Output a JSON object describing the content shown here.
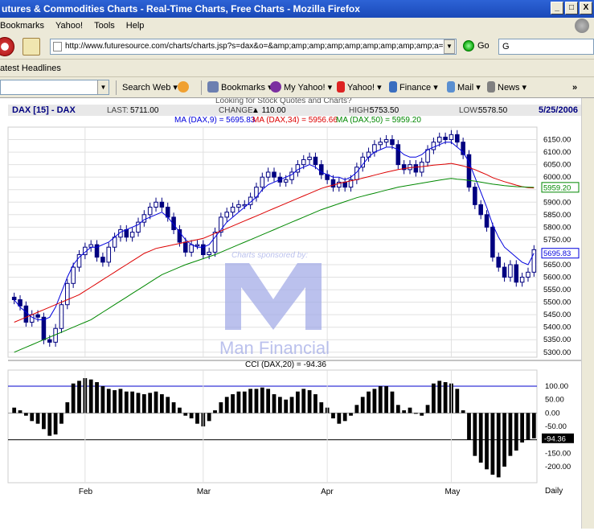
{
  "window": {
    "title": "utures & Commodities Charts - Real-Time Charts, Free Charts - Mozilla Firefox",
    "btn_min": "_",
    "btn_max": "□",
    "btn_close": "X"
  },
  "menu": {
    "items": [
      "Bookmarks",
      "Yahoo!",
      "Tools",
      "Help"
    ]
  },
  "nav": {
    "url": "http://www.futuresource.com/charts/charts.jsp?s=dax&o=&amp;amp;amp;amp;amp;amp;amp;amp;amp;a=",
    "go_label": "Go",
    "search_value": "G"
  },
  "bookmarks_bar": {
    "label": "atest Headlines"
  },
  "yahoo_toolbar": {
    "search_web": "Search Web ▾",
    "bookmarks": "Bookmarks ▾",
    "my_yahoo": "My Yahoo! ▾",
    "yahoo": "Yahoo! ▾",
    "finance": "Finance ▾",
    "mail": "Mail ▾",
    "news": "News ▾",
    "more": "»"
  },
  "chart_header": {
    "symbol": "DAX [15] - DAX",
    "last_label": "LAST:",
    "last": "5711.00",
    "change_label": "CHANGE:",
    "change": "▲ 110.00",
    "high_label": "HIGH:",
    "high": "5753.50",
    "low_label": "LOW:",
    "low": "5578.50",
    "date": "5/25/2006",
    "ma9": "MA (DAX,9) = 5695.83",
    "ma34": "MA (DAX,34) = 5956.66",
    "ma50": "MA (DAX,50) = 5959.20",
    "looking_for": "Looking for Stock Quotes and Charts?",
    "sponsor_text": "Charts sponsored by:",
    "sponsor_name": "Man Financial",
    "cci_label": "CCI (DAX,20) = -94.36",
    "daily": "Daily"
  },
  "colors": {
    "ma9": "#0000dd",
    "ma34": "#dd0000",
    "ma50": "#008800",
    "candle": "#000080",
    "logo": "#9fa8e6"
  },
  "chart_data": [
    {
      "type": "candlestick",
      "title": "DAX [15] - DAX",
      "ylim": [
        5280,
        6200
      ],
      "y_ticks": [
        "6150.00",
        "6100.00",
        "6050.00",
        "6000.00",
        "5950.00",
        "5900.00",
        "5850.00",
        "5800.00",
        "5750.00",
        "5700.00",
        "5650.00",
        "5600.00",
        "5550.00",
        "5500.00",
        "5450.00",
        "5400.00",
        "5350.00",
        "5300.00"
      ],
      "y_tick_values": [
        6150,
        6100,
        6050,
        6000,
        5950,
        5900,
        5850,
        5800,
        5750,
        5700,
        5650,
        5600,
        5550,
        5500,
        5450,
        5400,
        5350,
        5300
      ],
      "value_labels": [
        {
          "text": "5959.20",
          "value": 5959.2,
          "color": "#008800"
        },
        {
          "text": "5695.83",
          "value": 5695.83,
          "color": "#0000dd"
        }
      ],
      "x_labels": [
        "Feb",
        "Mar",
        "Apr",
        "May"
      ],
      "x_label_index": [
        12,
        32,
        53,
        74
      ],
      "closes": [
        5510,
        5485,
        5420,
        5450,
        5440,
        5350,
        5340,
        5395,
        5490,
        5575,
        5640,
        5690,
        5720,
        5730,
        5680,
        5660,
        5720,
        5760,
        5790,
        5760,
        5780,
        5820,
        5850,
        5880,
        5900,
        5880,
        5840,
        5790,
        5740,
        5700,
        5730,
        5730,
        5690,
        5700,
        5780,
        5840,
        5860,
        5880,
        5890,
        5890,
        5920,
        5960,
        6000,
        6020,
        6000,
        5980,
        5990,
        6020,
        6050,
        6070,
        6080,
        6050,
        6010,
        5990,
        5960,
        5980,
        5960,
        5990,
        6040,
        6080,
        6100,
        6130,
        6140,
        6150,
        6130,
        6050,
        6030,
        6050,
        6020,
        6060,
        6110,
        6140,
        6160,
        6150,
        6170,
        6140,
        6090,
        5960,
        5890,
        5850,
        5800,
        5680,
        5640,
        5600,
        5650,
        5580,
        5600,
        5620,
        5710
      ],
      "series": [
        {
          "name": "MA (DAX,9)",
          "values": [
            5510,
            5480,
            5460,
            5440,
            5430,
            5430,
            5440,
            5480,
            5540,
            5600,
            5650,
            5680,
            5700,
            5720,
            5720,
            5730,
            5740,
            5760,
            5780,
            5790,
            5800,
            5810,
            5830,
            5840,
            5850,
            5860,
            5840,
            5810,
            5780,
            5750,
            5730,
            5720,
            5720,
            5730,
            5760,
            5790,
            5820,
            5840,
            5860,
            5880,
            5900,
            5920,
            5950,
            5970,
            5980,
            5990,
            6000,
            6010,
            6030,
            6040,
            6050,
            6040,
            6020,
            6010,
            6000,
            6000,
            5990,
            6000,
            6020,
            6050,
            6080,
            6100,
            6110,
            6120,
            6120,
            6110,
            6090,
            6080,
            6080,
            6090,
            6110,
            6120,
            6130,
            6140,
            6140,
            6120,
            6100,
            6060,
            6000,
            5940,
            5880,
            5810,
            5760,
            5720,
            5700,
            5680,
            5660,
            5650,
            5695.83
          ]
        },
        {
          "name": "MA (DAX,34)",
          "values": [
            5420,
            5430,
            5440,
            5450,
            5460,
            5470,
            5480,
            5490,
            5500,
            5510,
            5520,
            5530,
            5545,
            5560,
            5575,
            5590,
            5605,
            5620,
            5635,
            5650,
            5665,
            5680,
            5695,
            5705,
            5715,
            5720,
            5725,
            5730,
            5735,
            5740,
            5745,
            5750,
            5755,
            5765,
            5775,
            5785,
            5795,
            5805,
            5815,
            5825,
            5835,
            5845,
            5855,
            5865,
            5875,
            5885,
            5895,
            5905,
            5915,
            5925,
            5935,
            5945,
            5955,
            5962,
            5968,
            5975,
            5980,
            5985,
            5990,
            5996,
            6002,
            6008,
            6014,
            6020,
            6025,
            6030,
            6034,
            6038,
            6040,
            6042,
            6045,
            6048,
            6050,
            6052,
            6055,
            6050,
            6045,
            6038,
            6030,
            6020,
            6010,
            5998,
            5990,
            5982,
            5975,
            5968,
            5962,
            5958,
            5956.66
          ]
        },
        {
          "name": "MA (DAX,50)",
          "values": [
            5300,
            5310,
            5320,
            5330,
            5340,
            5350,
            5360,
            5370,
            5380,
            5390,
            5400,
            5410,
            5420,
            5430,
            5445,
            5460,
            5475,
            5490,
            5505,
            5520,
            5535,
            5550,
            5565,
            5580,
            5595,
            5610,
            5620,
            5630,
            5640,
            5650,
            5658,
            5666,
            5674,
            5682,
            5690,
            5700,
            5710,
            5720,
            5730,
            5740,
            5750,
            5760,
            5770,
            5780,
            5790,
            5800,
            5810,
            5820,
            5830,
            5840,
            5850,
            5860,
            5870,
            5878,
            5886,
            5894,
            5902,
            5910,
            5918,
            5924,
            5930,
            5936,
            5942,
            5948,
            5954,
            5960,
            5964,
            5968,
            5972,
            5976,
            5980,
            5984,
            5988,
            5992,
            5995,
            5992,
            5990,
            5987,
            5984,
            5980,
            5976,
            5972,
            5969,
            5966,
            5964,
            5962,
            5961,
            5960,
            5959.2
          ]
        }
      ]
    },
    {
      "type": "bar",
      "title": "CCI (DAX,20) = -94.36",
      "ylim": [
        -260,
        160
      ],
      "y_ticks": [
        "100.00",
        "50.00",
        "0.00",
        "-50.00",
        "-150.00",
        "-200.00"
      ],
      "y_tick_values": [
        100,
        50,
        0,
        -50,
        -150,
        -200
      ],
      "value_label": "-94.36",
      "reference_lines": [
        100,
        -100
      ],
      "values": [
        20,
        10,
        -10,
        -30,
        -40,
        -60,
        -85,
        -80,
        -40,
        40,
        110,
        120,
        130,
        125,
        115,
        100,
        90,
        85,
        90,
        80,
        80,
        75,
        70,
        75,
        80,
        70,
        60,
        40,
        20,
        -10,
        -20,
        -40,
        -50,
        -30,
        10,
        40,
        60,
        70,
        80,
        80,
        90,
        90,
        95,
        90,
        70,
        60,
        50,
        60,
        80,
        90,
        85,
        70,
        40,
        20,
        -20,
        -40,
        -30,
        -10,
        30,
        60,
        80,
        90,
        100,
        100,
        80,
        30,
        10,
        20,
        0,
        -10,
        30,
        110,
        120,
        115,
        110,
        90,
        10,
        -100,
        -160,
        -185,
        -210,
        -230,
        -240,
        -200,
        -160,
        -140,
        -110,
        -100,
        -94.36
      ]
    }
  ]
}
